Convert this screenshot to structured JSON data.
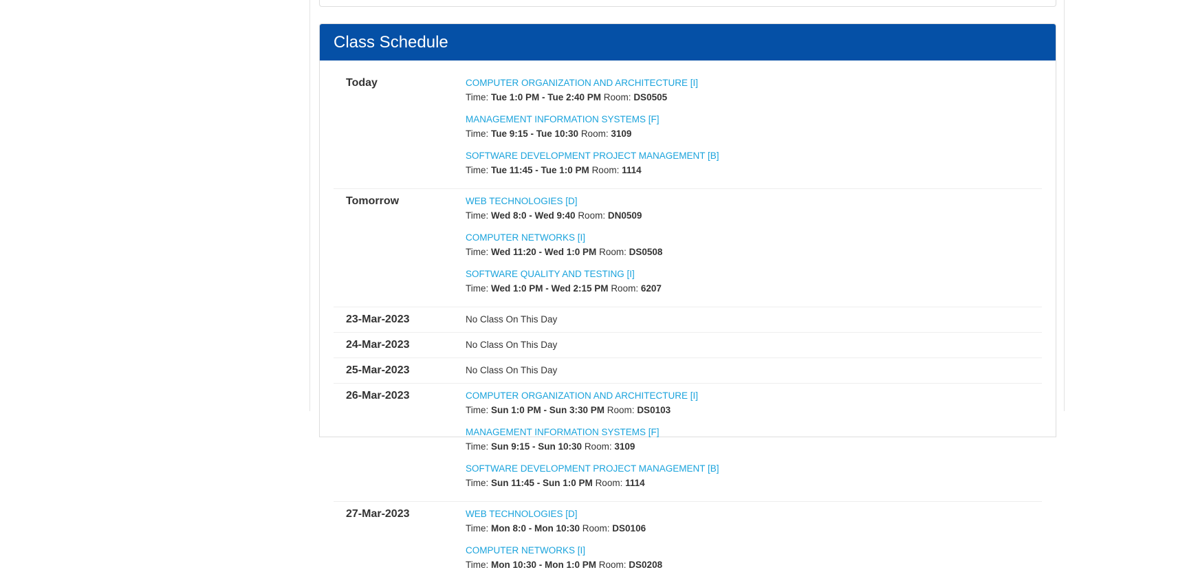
{
  "schedule": {
    "title": "Class Schedule",
    "time_label": "Time: ",
    "room_label": "Room: ",
    "days": [
      {
        "label": "Today",
        "classes": [
          {
            "name": "COMPUTER ORGANIZATION AND ARCHITECTURE [I]",
            "time": "Tue 1:0 PM - Tue 2:40 PM",
            "room": "DS0505"
          },
          {
            "name": "MANAGEMENT INFORMATION SYSTEMS [F]",
            "time": "Tue 9:15 - Tue 10:30",
            "room": "3109"
          },
          {
            "name": "SOFTWARE DEVELOPMENT PROJECT MANAGEMENT [B]",
            "time": "Tue 11:45 - Tue 1:0 PM",
            "room": "1114"
          }
        ]
      },
      {
        "label": "Tomorrow",
        "classes": [
          {
            "name": "WEB TECHNOLOGIES [D]",
            "time": "Wed 8:0 - Wed 9:40",
            "room": "DN0509"
          },
          {
            "name": "COMPUTER NETWORKS [I]",
            "time": "Wed 11:20 - Wed 1:0 PM",
            "room": "DS0508"
          },
          {
            "name": "SOFTWARE QUALITY AND TESTING [I]",
            "time": "Wed 1:0 PM - Wed 2:15 PM",
            "room": "6207"
          }
        ]
      },
      {
        "label": "23-Mar-2023",
        "no_class": "No Class On This Day",
        "classes": []
      },
      {
        "label": "24-Mar-2023",
        "no_class": "No Class On This Day",
        "classes": []
      },
      {
        "label": "25-Mar-2023",
        "no_class": "No Class On This Day",
        "classes": []
      },
      {
        "label": "26-Mar-2023",
        "classes": [
          {
            "name": "COMPUTER ORGANIZATION AND ARCHITECTURE [I]",
            "time": "Sun 1:0 PM - Sun 3:30 PM",
            "room": "DS0103"
          },
          {
            "name": "MANAGEMENT INFORMATION SYSTEMS [F]",
            "time": "Sun 9:15 - Sun 10:30",
            "room": "3109"
          },
          {
            "name": "SOFTWARE DEVELOPMENT PROJECT MANAGEMENT [B]",
            "time": "Sun 11:45 - Sun 1:0 PM",
            "room": "1114"
          }
        ]
      },
      {
        "label": "27-Mar-2023",
        "classes": [
          {
            "name": "WEB TECHNOLOGIES [D]",
            "time": "Mon 8:0 - Mon 10:30",
            "room": "DS0106"
          },
          {
            "name": "COMPUTER NETWORKS [I]",
            "time": "Mon 10:30 - Mon 1:0 PM",
            "room": "DS0208"
          }
        ]
      }
    ]
  }
}
